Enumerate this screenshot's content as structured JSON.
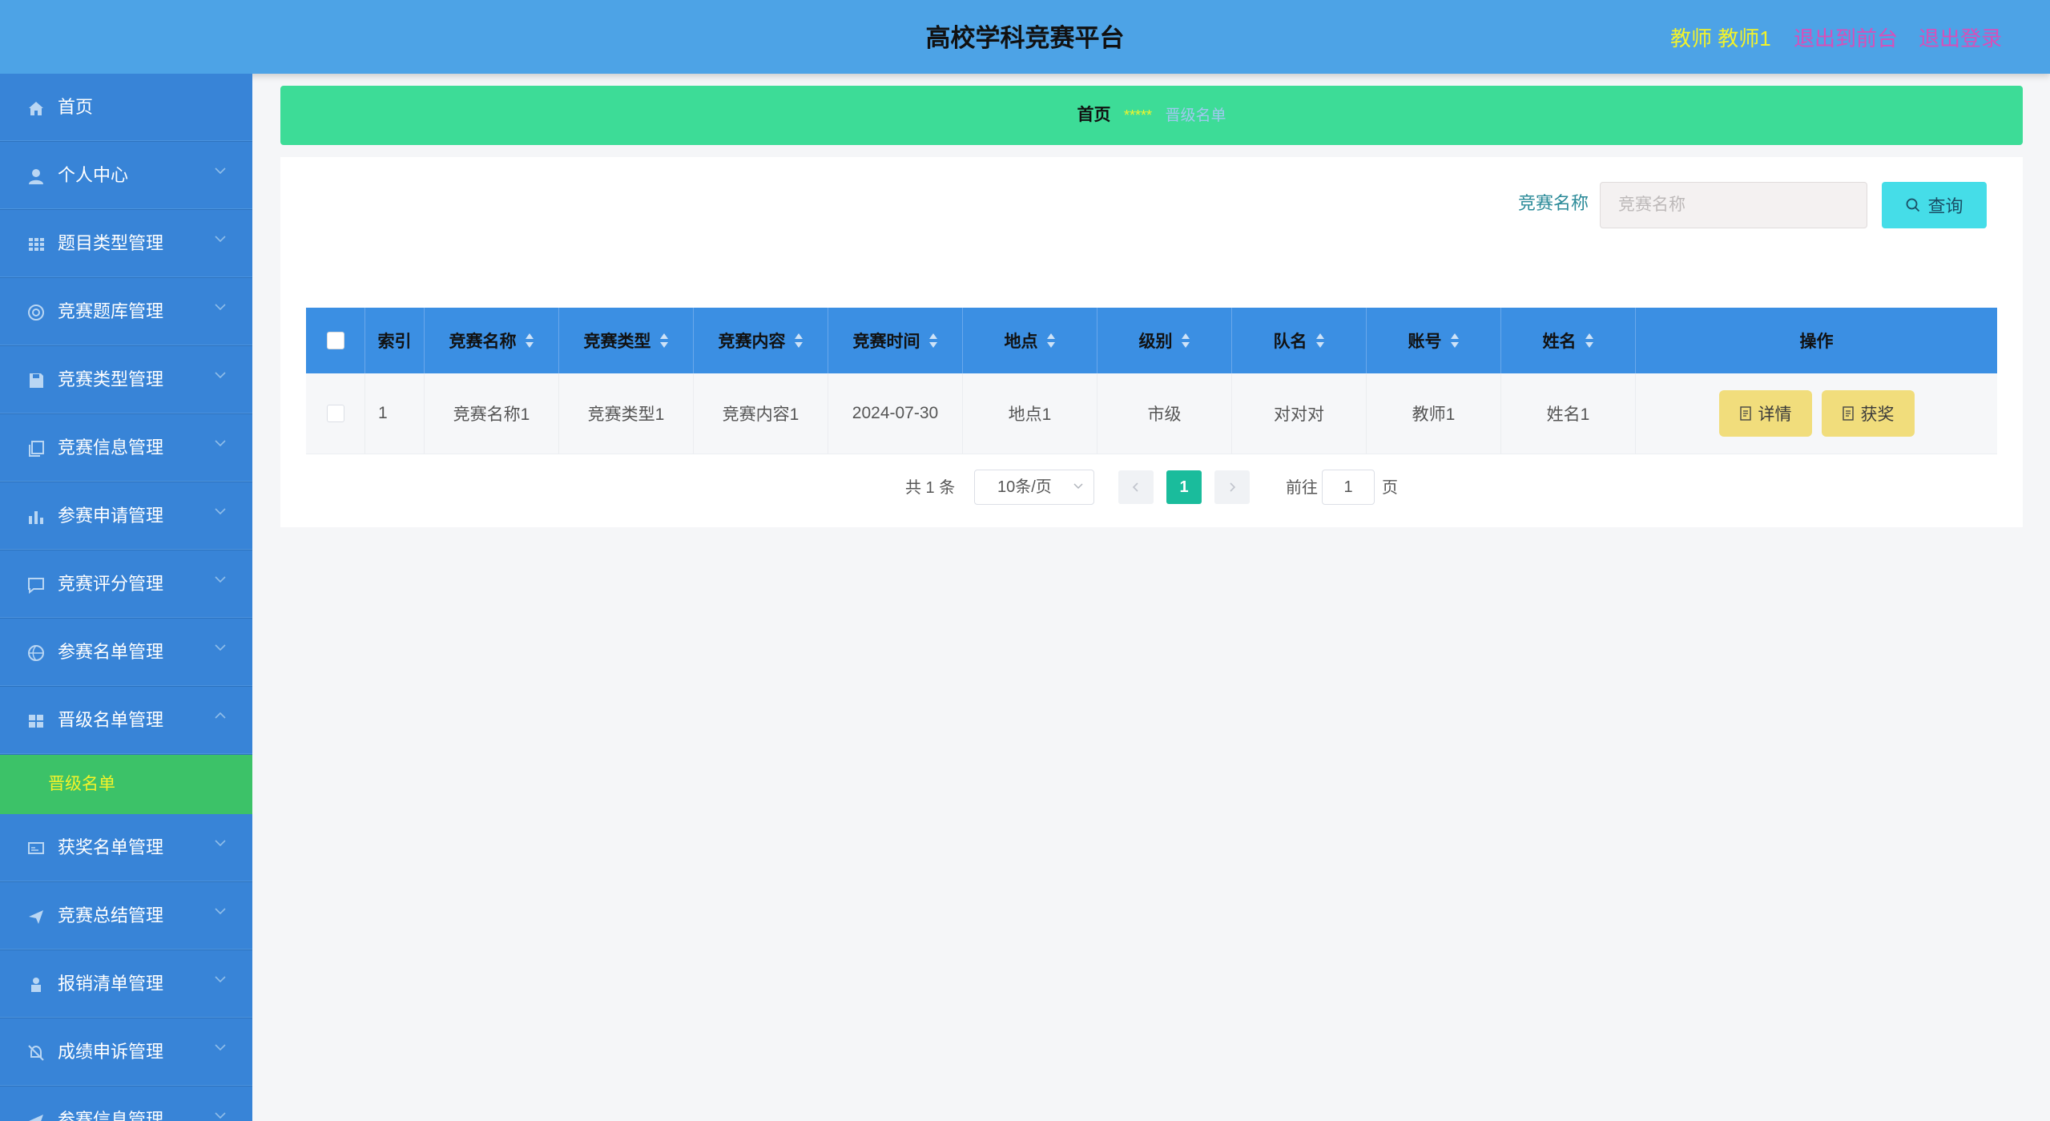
{
  "header": {
    "title": "高校学科竞赛平台",
    "role_user": "教师 教师1",
    "to_front": "退出到前台",
    "logout": "退出登录"
  },
  "sidebar": {
    "items": [
      {
        "label": "首页",
        "icon": "home-icon"
      },
      {
        "label": "个人中心",
        "icon": "user-icon"
      },
      {
        "label": "题目类型管理",
        "icon": "grid-icon"
      },
      {
        "label": "竞赛题库管理",
        "icon": "disc-icon"
      },
      {
        "label": "竞赛类型管理",
        "icon": "save-icon"
      },
      {
        "label": "竞赛信息管理",
        "icon": "copy-icon"
      },
      {
        "label": "参赛申请管理",
        "icon": "bar-chart-icon"
      },
      {
        "label": "竞赛评分管理",
        "icon": "chat-icon"
      },
      {
        "label": "参赛名单管理",
        "icon": "basketball-icon"
      },
      {
        "label": "晋级名单管理",
        "icon": "menu-grid-icon"
      },
      {
        "label": "获奖名单管理",
        "icon": "monitor-icon"
      },
      {
        "label": "竞赛总结管理",
        "icon": "send-icon"
      },
      {
        "label": "报销清单管理",
        "icon": "person-icon"
      },
      {
        "label": "成绩申诉管理",
        "icon": "bell-off-icon"
      },
      {
        "label": "参赛信息管理",
        "icon": "send-icon"
      }
    ],
    "submenu_label": "晋级名单"
  },
  "breadcrumb": {
    "home": "首页",
    "separator": "*****",
    "current": "晋级名单"
  },
  "search": {
    "label": "竞赛名称",
    "placeholder": "竞赛名称",
    "button": "查询"
  },
  "table": {
    "columns": [
      "索引",
      "竞赛名称",
      "竞赛类型",
      "竞赛内容",
      "竞赛时间",
      "地点",
      "级别",
      "队名",
      "账号",
      "姓名",
      "操作"
    ],
    "rows": [
      {
        "index": "1",
        "name": "竞赛名称1",
        "type": "竞赛类型1",
        "content": "竞赛内容1",
        "time": "2024-07-30",
        "place": "地点1",
        "level": "市级",
        "team": "对对对",
        "account": "教师1",
        "person": "姓名1",
        "detail_btn": "详情",
        "award_btn": "获奖"
      }
    ]
  },
  "pagination": {
    "total": "共 1 条",
    "page_size": "10条/页",
    "current_page": "1",
    "goto_prefix": "前往",
    "goto_value": "1",
    "goto_suffix": "页"
  },
  "colors": {
    "header_bg": "#4da3e6",
    "sidebar_bg": "#3884d7",
    "submenu_active_bg": "#3cc268",
    "breadcrumb_bg": "#3ddc97",
    "table_head_bg": "#3b8fe3",
    "action_btn": "#f1dd7c",
    "search_btn": "#45dde8",
    "page_active": "#1abc9c"
  }
}
